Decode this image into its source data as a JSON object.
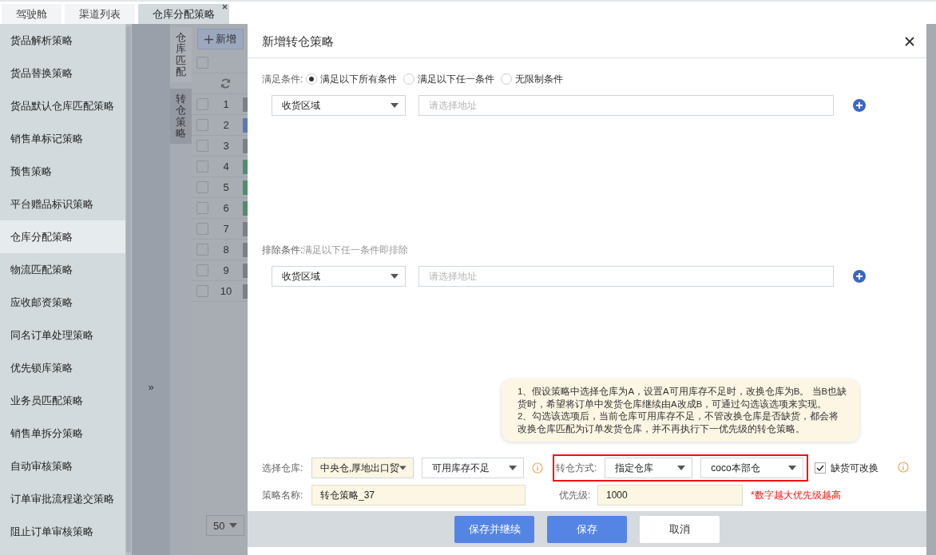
{
  "top_tabs": [
    {
      "label": "驾驶舱",
      "selected": false,
      "closable": false
    },
    {
      "label": "渠道列表",
      "selected": false,
      "closable": false
    },
    {
      "label": "仓库分配策略",
      "selected": true,
      "closable": true
    }
  ],
  "sidebar": {
    "items": [
      {
        "label": "货品解析策略",
        "selected": false
      },
      {
        "label": "货品替换策略",
        "selected": false
      },
      {
        "label": "货品默认仓库匹配策略",
        "selected": false
      },
      {
        "label": "销售单标记策略",
        "selected": false
      },
      {
        "label": "预售策略",
        "selected": false
      },
      {
        "label": "平台赠品标识策略",
        "selected": false
      },
      {
        "label": "仓库分配策略",
        "selected": true
      },
      {
        "label": "物流匹配策略",
        "selected": false
      },
      {
        "label": "应收邮资策略",
        "selected": false
      },
      {
        "label": "同名订单处理策略",
        "selected": false
      },
      {
        "label": "优先锁库策略",
        "selected": false
      },
      {
        "label": "业务员匹配策略",
        "selected": false
      },
      {
        "label": "销售单拆分策略",
        "selected": false
      },
      {
        "label": "自动审核策略",
        "selected": false
      },
      {
        "label": "订单审批流程递交策略",
        "selected": false
      },
      {
        "label": "阻止订单审核策略",
        "selected": false
      }
    ]
  },
  "collapse_toggle": "»",
  "side_tabs": [
    {
      "label": "仓库匹配",
      "selected": false
    },
    {
      "label": "转仓策略",
      "selected": true
    }
  ],
  "add_button": "新增",
  "table": {
    "select_all_checked": false,
    "rows": [
      {
        "number": "1",
        "color": "#7b7f86",
        "checked": false
      },
      {
        "number": "2",
        "color": "#5b79b5",
        "checked": false
      },
      {
        "number": "3",
        "color": "#7b7f86",
        "checked": false
      },
      {
        "number": "4",
        "color": "#4f8d6e",
        "checked": false
      },
      {
        "number": "5",
        "color": "#4f8d6e",
        "checked": false
      },
      {
        "number": "6",
        "color": "#4f8d6e",
        "checked": false
      },
      {
        "number": "7",
        "color": "#7b7f86",
        "checked": false
      },
      {
        "number": "8",
        "color": "#7b7f86",
        "checked": false
      },
      {
        "number": "9",
        "color": "#7b7f86",
        "checked": false
      },
      {
        "number": "10",
        "color": "#7b7f86",
        "checked": false
      }
    ]
  },
  "pager": {
    "page_size": "50"
  },
  "dialog": {
    "title": "新增转仓策略",
    "match": {
      "label": "满足条件:",
      "options": [
        {
          "label": "满足以下所有条件",
          "selected": true
        },
        {
          "label": "满足以下任一条件",
          "selected": false
        },
        {
          "label": "无限制条件",
          "selected": false
        }
      ],
      "rows": [
        {
          "field": "收货区域",
          "placeholder": "请选择地址"
        }
      ]
    },
    "exclude": {
      "label": "排除条件:",
      "hint": "满足以下任一条件即排除",
      "rows": [
        {
          "field": "收货区域",
          "placeholder": "请选择地址"
        }
      ]
    },
    "tooltip": [
      "1、假设策略中选择仓库为A，设置A可用库存不足时，改换仓库为B。 当B也缺货时，希望将订单中发货仓库继续由A改成B，可通过勾选该选项来实现。",
      "2、勾选该选项后，当前仓库可用库存不足，不管改换仓库是否缺货，都会将改换仓库匹配为订单发货仓库，并不再执行下一优先级的转仓策略。"
    ],
    "warehouse_label": "选择仓库:",
    "warehouse": "中央仓,厚地出口贸",
    "trigger": "可用库存不足",
    "transfer_label": "转仓方式:",
    "transfer_mode": "指定仓库",
    "target_warehouse": "coco本部仓",
    "swap_checkbox": {
      "label": "缺货可改换",
      "checked": true
    },
    "name_label": "策略名称:",
    "name": "转仓策略_37",
    "priority_label": "优先级:",
    "priority": "1000",
    "priority_note": "*数字越大优先级越高",
    "buttons": [
      {
        "label": "保存并继续",
        "kind": "primary"
      },
      {
        "label": "保存",
        "kind": "primary"
      },
      {
        "label": "取消",
        "kind": "default"
      }
    ]
  }
}
